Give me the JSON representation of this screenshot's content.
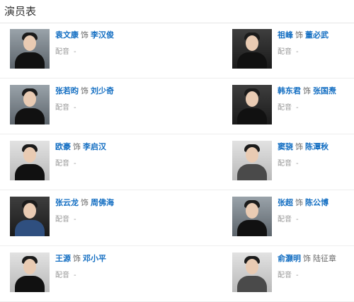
{
  "header": {
    "title": "演员表"
  },
  "dub_label": "配音",
  "dub_value": "-",
  "connector": "饰",
  "cast": [
    {
      "actor": "袁文康",
      "role": "李汉俊"
    },
    {
      "actor": "祖峰",
      "role": "董必武"
    },
    {
      "actor": "张若昀",
      "role": "刘少奇"
    },
    {
      "actor": "韩东君",
      "role": "张国焘"
    },
    {
      "actor": "欧豪",
      "role": "李启汉"
    },
    {
      "actor": "窦骁",
      "role": "陈潭秋"
    },
    {
      "actor": "张云龙",
      "role": "周佛海"
    },
    {
      "actor": "张超",
      "role": "陈公博"
    },
    {
      "actor": "王源",
      "role": "邓小平"
    },
    {
      "actor": "俞灏明",
      "role": "陆征章"
    }
  ]
}
